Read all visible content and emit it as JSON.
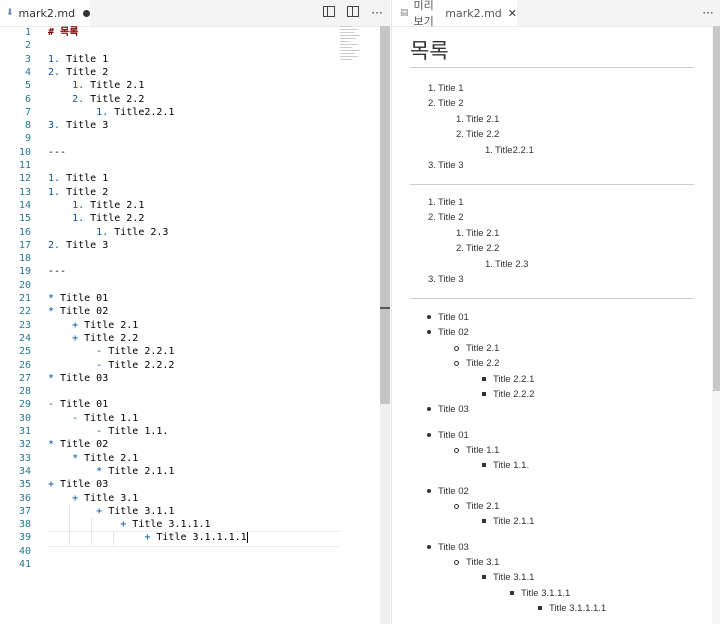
{
  "editor_tab": {
    "filename": "mark2.md",
    "dirty_indicator": "●"
  },
  "editor_tools": {
    "split_label": "",
    "more": "···"
  },
  "preview_tab": {
    "prefix": "미리 보기",
    "filename": "mark2.md",
    "close": "✕"
  },
  "preview_tools": {
    "more": "···"
  },
  "editor_lines": [
    {
      "n": "1",
      "t": "# 목록"
    },
    {
      "n": "2",
      "t": ""
    },
    {
      "n": "3",
      "t": "1. Title 1"
    },
    {
      "n": "4",
      "t": "2. Title 2"
    },
    {
      "n": "5",
      "t": "    1. Title 2.1"
    },
    {
      "n": "6",
      "t": "    2. Title 2.2"
    },
    {
      "n": "7",
      "t": "        1. Title2.2.1"
    },
    {
      "n": "8",
      "t": "3. Title 3"
    },
    {
      "n": "9",
      "t": ""
    },
    {
      "n": "10",
      "t": "---"
    },
    {
      "n": "11",
      "t": ""
    },
    {
      "n": "12",
      "t": "1. Title 1"
    },
    {
      "n": "13",
      "t": "1. Title 2"
    },
    {
      "n": "14",
      "t": "    1. Title 2.1"
    },
    {
      "n": "15",
      "t": "    1. Title 2.2"
    },
    {
      "n": "16",
      "t": "        1. Title 2.3"
    },
    {
      "n": "17",
      "t": "2. Title 3"
    },
    {
      "n": "18",
      "t": ""
    },
    {
      "n": "19",
      "t": "---"
    },
    {
      "n": "20",
      "t": ""
    },
    {
      "n": "21",
      "t": "* Title 01"
    },
    {
      "n": "22",
      "t": "* Title 02"
    },
    {
      "n": "23",
      "t": "    + Title 2.1"
    },
    {
      "n": "24",
      "t": "    + Title 2.2"
    },
    {
      "n": "25",
      "t": "        - Title 2.2.1"
    },
    {
      "n": "26",
      "t": "        - Title 2.2.2"
    },
    {
      "n": "27",
      "t": "* Title 03"
    },
    {
      "n": "28",
      "t": ""
    },
    {
      "n": "29",
      "t": "- Title 01"
    },
    {
      "n": "30",
      "t": "    - Title 1.1"
    },
    {
      "n": "31",
      "t": "        - Title 1.1."
    },
    {
      "n": "32",
      "t": "* Title 02"
    },
    {
      "n": "33",
      "t": "    * Title 2.1"
    },
    {
      "n": "34",
      "t": "        * Title 2.1.1"
    },
    {
      "n": "35",
      "t": "+ Title 03"
    },
    {
      "n": "36",
      "t": "    + Title 3.1"
    },
    {
      "n": "37",
      "t": "        + Title 3.1.1"
    },
    {
      "n": "38",
      "t": "            + Title 3.1.1.1"
    },
    {
      "n": "39",
      "t": "                + Title 3.1.1.1.1"
    },
    {
      "n": "40",
      "t": ""
    },
    {
      "n": "41",
      "t": ""
    }
  ],
  "preview": {
    "heading": "목록",
    "ordered_a": [
      "1.",
      "Title 1",
      "2.",
      "Title 2",
      "1.",
      "Title 2.1",
      "2.",
      "Title 2.2",
      "1.",
      "Title2.2.1",
      "3.",
      "Title 3"
    ],
    "ordered_b": [
      "1.",
      "Title 1",
      "2.",
      "Title 2",
      "1.",
      "Title 2.1",
      "2.",
      "Title 2.2",
      "1.",
      "Title 2.3",
      "3.",
      "Title 3"
    ],
    "bullets_a": [
      "Title 01",
      "Title 02",
      "Title 2.1",
      "Title 2.2",
      "Title 2.2.1",
      "Title 2.2.2",
      "Title 03"
    ],
    "bullets_b": [
      "Title 01",
      "Title 1.1",
      "Title 1.1."
    ],
    "bullets_c": [
      "Title 02",
      "Title 2.1",
      "Title 2.1.1"
    ],
    "bullets_d": [
      "Title 03",
      "Title 3.1",
      "Title 3.1.1",
      "Title 3.1.1.1",
      "Title 3.1.1.1.1"
    ]
  }
}
